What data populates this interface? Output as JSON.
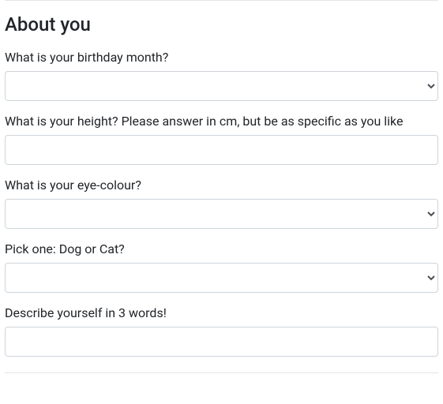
{
  "section": {
    "heading": "About you"
  },
  "fields": {
    "birthday": {
      "label": "What is your birthday month?",
      "value": ""
    },
    "height": {
      "label": "What is your height? Please answer in cm, but be as specific as you like",
      "value": ""
    },
    "eye_colour": {
      "label": "What is your eye-colour?",
      "value": ""
    },
    "dog_or_cat": {
      "label": "Pick one: Dog or Cat?",
      "value": ""
    },
    "three_words": {
      "label": "Describe yourself in 3 words!",
      "value": ""
    }
  }
}
